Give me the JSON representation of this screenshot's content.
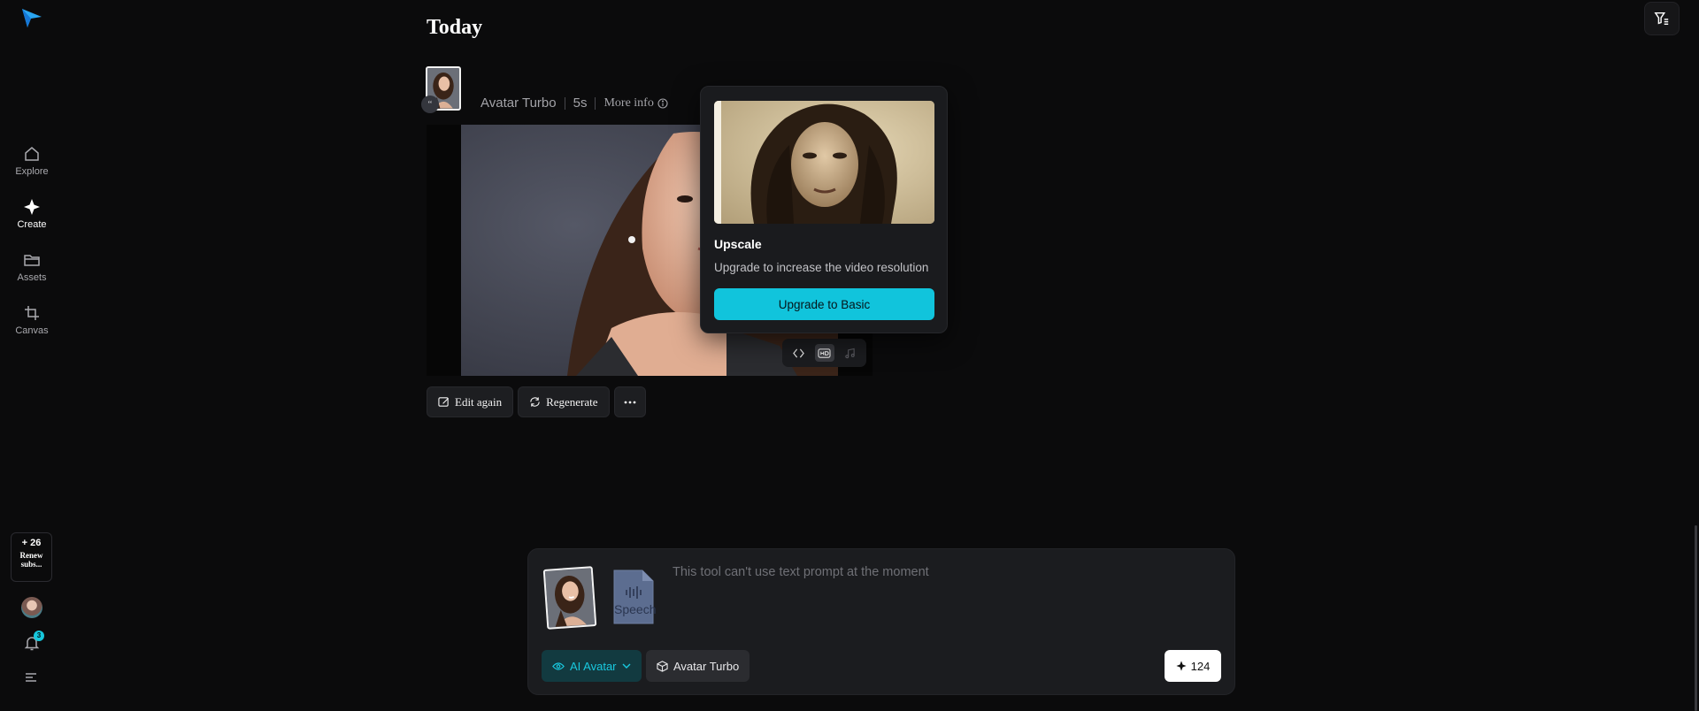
{
  "sidebar": {
    "nav": [
      {
        "label": "Explore",
        "icon": "home-icon",
        "active": false
      },
      {
        "label": "Create",
        "icon": "sparkle-icon",
        "active": true
      },
      {
        "label": "Assets",
        "icon": "folder-icon",
        "active": false
      },
      {
        "label": "Canvas",
        "icon": "crop-icon",
        "active": false
      }
    ],
    "credits": {
      "count": "+ 26",
      "label": "Renew subs..."
    },
    "notifications_count": "3"
  },
  "main": {
    "heading": "Today",
    "item": {
      "model": "Avatar Turbo",
      "duration": "5s",
      "more_info": "More info"
    },
    "actions": {
      "edit_again": "Edit again",
      "regenerate": "Regenerate"
    }
  },
  "popover": {
    "title": "Upscale",
    "description": "Upgrade to increase the video resolution",
    "button": "Upgrade to Basic"
  },
  "composer": {
    "speech_label": "Speech",
    "placeholder": "This tool can't use text prompt at the moment",
    "mode_chip": "AI Avatar",
    "model_chip": "Avatar Turbo",
    "credits": "124"
  },
  "colors": {
    "accent": "#11c4dc",
    "background": "#0b0b0c",
    "panel": "#1b1c1f"
  }
}
